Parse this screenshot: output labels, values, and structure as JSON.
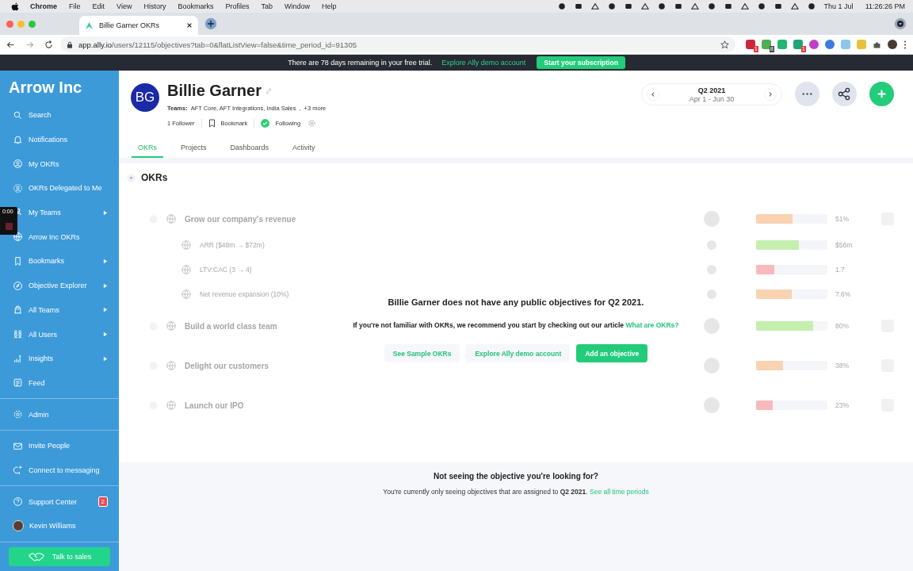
{
  "menubar": {
    "app": "Chrome",
    "items": [
      "File",
      "Edit",
      "View",
      "History",
      "Bookmarks",
      "Profiles",
      "Tab",
      "Window",
      "Help"
    ],
    "date": "Thu 1 Jul",
    "time": "11:26:26 PM"
  },
  "browser": {
    "tab_title": "Billie Garner OKRs",
    "url_host": "app.ally.io",
    "url_path": "/users/12115/objectives?tab=0&flatListView=false&time_period_id=91305",
    "extension_badges": [
      "1",
      "8",
      "1"
    ]
  },
  "banner": {
    "text": "There are 78 days remaining in your free trial.",
    "link": "Explore Ally demo account",
    "button": "Start your subscription"
  },
  "recorder": {
    "time": "0:00"
  },
  "sidebar": {
    "brand": "Arrow Inc",
    "sections": [
      [
        {
          "label": "Search",
          "kind": "search",
          "arrow": false
        },
        {
          "label": "Notifications",
          "kind": "bell",
          "arrow": false
        },
        {
          "label": "My OKRs",
          "kind": "user",
          "arrow": false
        },
        {
          "label": "OKRs Delegated to Me",
          "kind": "delegated",
          "arrow": false
        },
        {
          "label": "My Teams",
          "kind": "team",
          "arrow": true
        },
        {
          "label": "Arrow Inc OKRs",
          "kind": "globe",
          "arrow": false
        },
        {
          "label": "Bookmarks",
          "kind": "bookmark",
          "arrow": true
        },
        {
          "label": "Objective Explorer",
          "kind": "compass",
          "arrow": true
        },
        {
          "label": "All Teams",
          "kind": "building",
          "arrow": true
        },
        {
          "label": "All Users",
          "kind": "users",
          "arrow": true
        },
        {
          "label": "Insights",
          "kind": "chart",
          "arrow": true
        },
        {
          "label": "Feed",
          "kind": "feed",
          "arrow": false
        }
      ],
      [
        {
          "label": "Admin",
          "kind": "gear",
          "arrow": false
        }
      ],
      [
        {
          "label": "Invite People",
          "kind": "mail",
          "arrow": false
        },
        {
          "label": "Connect to messaging",
          "kind": "chat",
          "arrow": false
        }
      ],
      [
        {
          "label": "Support Center",
          "kind": "help",
          "arrow": false,
          "badge": "2"
        },
        {
          "label": "Kevin Williams",
          "kind": "avatar",
          "arrow": false
        }
      ]
    ],
    "cta": "Talk to sales"
  },
  "profile": {
    "initials": "BG",
    "name": "Billie Garner",
    "teams_label": "Teams:",
    "teams": "AFT Core, AFT Integrations, India Sales",
    "teams_separator": ",",
    "more": "+3 more",
    "followers": "1 Follower",
    "bookmark": "Bookmark",
    "following_label": "Following",
    "following": true
  },
  "period": {
    "label": "Q2 2021",
    "range": "Apr 1 - Jun 30"
  },
  "tabs": [
    {
      "label": "OKRs",
      "selected": true
    },
    {
      "label": "Projects",
      "selected": false
    },
    {
      "label": "Dashboards",
      "selected": false
    },
    {
      "label": "Activity",
      "selected": false
    }
  ],
  "section": {
    "title": "OKRs",
    "expanded": true
  },
  "objectives": [
    {
      "title": "Grow our company's revenue",
      "level": 0.51,
      "color": "#f9d2b2",
      "value": "51%",
      "children": [
        {
          "title": "ARR ($48m → $72m)",
          "level": 0.6,
          "color": "#c4efae",
          "value": "$56m"
        },
        {
          "title": "LTV:CAC (3 → 4)",
          "level": 0.25,
          "color": "#f8b9bd",
          "value": "1.7"
        },
        {
          "title": "Net revenue expansion (10%)",
          "level": 0.5,
          "color": "#f9d2b2",
          "value": "7.6%"
        }
      ]
    },
    {
      "title": "Build a world class team",
      "level": 0.8,
      "color": "#c4efae",
      "value": "80%"
    },
    {
      "title": "Delight our customers",
      "level": 0.38,
      "color": "#f9d2b2",
      "value": "38%"
    },
    {
      "title": "Launch our IPO",
      "level": 0.23,
      "color": "#f8b9bd",
      "value": "23%"
    }
  ],
  "empty_state": {
    "title": "Billie Garner does not have any public objectives for Q2 2021.",
    "text": "If you're not familiar with OKRs, we recommend you start by checking out our article",
    "link": "What are OKRs?",
    "buttons": [
      {
        "label": "See Sample OKRs",
        "kind": "secondary"
      },
      {
        "label": "Explore Ally demo account",
        "kind": "secondary"
      },
      {
        "label": "Add an objective",
        "kind": "primary"
      }
    ]
  },
  "footer": {
    "title": "Not seeing the objective you're looking for?",
    "text": "You're currently only seeing objectives that are assigned to **Q2 2021**.",
    "link": "See all time periods"
  }
}
